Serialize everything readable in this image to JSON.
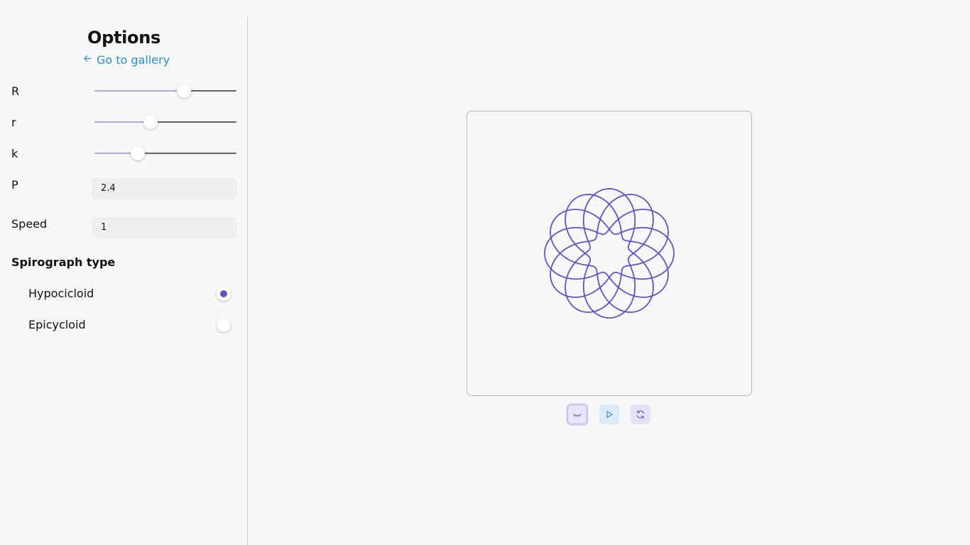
{
  "sidebar": {
    "title": "Options",
    "back_link": "Go to gallery",
    "sliders": [
      {
        "label": "R",
        "value_fraction": 0.63
      },
      {
        "label": "r",
        "value_fraction": 0.395
      },
      {
        "label": "k",
        "value_fraction": 0.305
      }
    ],
    "inputs": [
      {
        "label": "P",
        "value": "2.4"
      },
      {
        "label": "Speed",
        "value": "1"
      }
    ],
    "spirograph_type": {
      "title": "Spirograph type",
      "options": [
        {
          "label": "Hypocicloid",
          "selected": true
        },
        {
          "label": "Epicycloid",
          "selected": false
        }
      ]
    }
  },
  "canvas": {
    "curve_color": "#6452c4"
  },
  "controls": {
    "hide_icon": "eye-closed-icon",
    "play_icon": "play-icon",
    "reset_icon": "refresh-icon"
  },
  "colors": {
    "accent": "#6452c4",
    "link": "#2a8fd6",
    "slider_fill": "#b3a6ea"
  }
}
